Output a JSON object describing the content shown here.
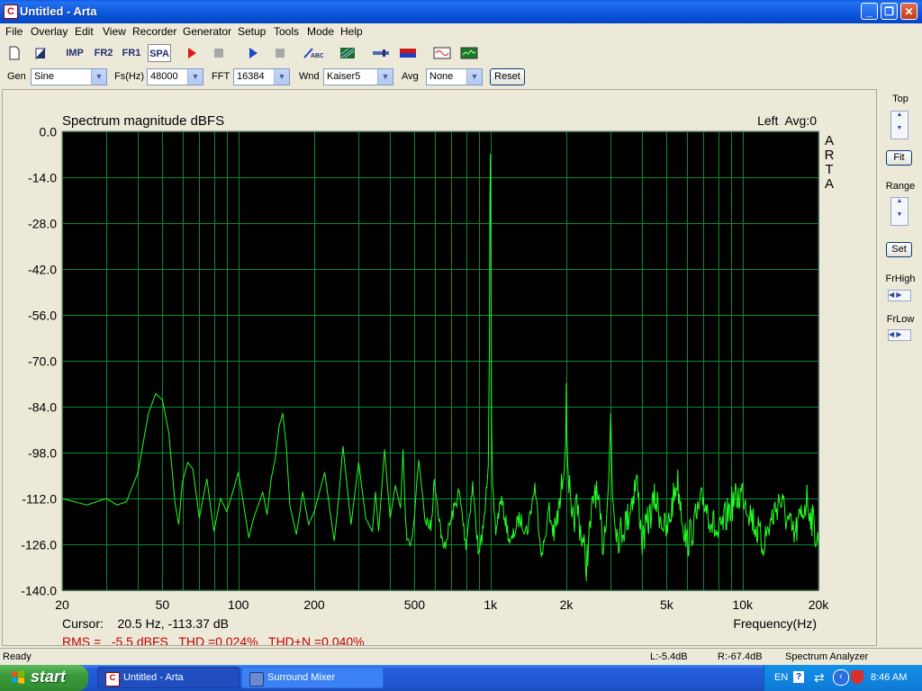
{
  "window": {
    "title": "Untitled - Arta",
    "app_icon_letter": "C"
  },
  "menu": [
    "File",
    "Overlay",
    "Edit",
    "View",
    "Recorder",
    "Generator",
    "Setup",
    "Tools",
    "Mode",
    "Help"
  ],
  "toolbar": {
    "buttons": [
      "new-document-icon",
      "open-icon",
      "impulse-mode",
      "fr2-mode",
      "fr1-mode",
      "spectrum-mode",
      "record-icon",
      "stop-icon",
      "play-icon",
      "stop-icon",
      "abc-icon",
      "grid-icon",
      "marker-icon",
      "color-bar-icon",
      "sine-wave-icon",
      "spectrum-icon"
    ],
    "imp_label": "IMP",
    "fr2_label": "FR2",
    "fr1_label": "FR1",
    "spa_label": "SPA"
  },
  "genbar": {
    "gen_label": "Gen",
    "gen_value": "Sine",
    "fs_label": "Fs(Hz)",
    "fs_value": "48000",
    "fft_label": "FFT",
    "fft_value": "16384",
    "wnd_label": "Wnd",
    "wnd_value": "Kaiser5",
    "avg_label": "Avg",
    "avg_value": "None",
    "reset_label": "Reset"
  },
  "right_panel": {
    "top_label": "Top",
    "fit_label": "Fit",
    "range_label": "Range",
    "set_label": "Set",
    "frhigh_label": "FrHigh",
    "frlow_label": "FrLow"
  },
  "status": {
    "ready": "Ready",
    "left_level": "L:-5.4dB",
    "right_level": "R:-67.4dB",
    "mode": "Spectrum Analyzer"
  },
  "taskbar": {
    "start": "start",
    "tasks": [
      "Untitled - Arta",
      "Surround Mixer"
    ],
    "lang": "EN",
    "time": "8:46 AM"
  },
  "chart_data": {
    "type": "line",
    "title": "Spectrum magnitude dBFS",
    "channel_info": "Left  Avg:0",
    "watermark": "ARTA",
    "xlabel": "Frequency(Hz)",
    "x_scale": "log",
    "xlim": [
      20,
      20000
    ],
    "ylim": [
      -140,
      0
    ],
    "y_ticks": [
      "0.0",
      "-14.0",
      "-28.0",
      "-42.0",
      "-56.0",
      "-70.0",
      "-84.0",
      "-98.0",
      "-112.0",
      "-126.0",
      "-140.0"
    ],
    "x_ticks": [
      "20",
      "50",
      "100",
      "200",
      "500",
      "1k",
      "2k",
      "5k",
      "10k",
      "20k"
    ],
    "grid": true,
    "background": "#000000",
    "grid_color": "#0a8a2a",
    "line_color": "#22ff22",
    "cursor_text": "Cursor:    20.5 Hz, -113.37 dB",
    "rms_text": "RMS =   -5.5 dBFS   THD =0.024%   THD+N =0.040%",
    "series": [
      {
        "x": [
          20,
          25,
          30,
          33,
          36,
          40,
          44,
          47,
          50,
          53,
          56,
          58,
          60,
          63,
          66,
          70,
          75,
          80,
          85,
          90,
          95,
          100,
          105,
          110,
          115,
          120,
          125,
          130,
          135,
          140,
          145,
          150,
          155,
          160,
          170,
          180,
          190,
          200,
          210,
          220,
          240,
          250,
          260,
          280,
          300,
          320,
          340,
          350,
          360,
          380,
          400,
          420,
          440,
          450,
          460,
          480,
          500,
          520,
          550,
          580,
          600,
          650,
          700,
          750,
          800,
          850,
          900,
          950,
          980,
          990,
          995,
          1000,
          1005,
          1010,
          1020,
          1050,
          1100,
          1200,
          1300,
          1400,
          1500,
          1600,
          1700,
          1800,
          1900,
          1980,
          2000,
          2020,
          2100,
          2200,
          2400,
          2600,
          2800,
          2950,
          3000,
          3050,
          3200,
          3500,
          3800,
          4000,
          4500,
          5000,
          5500,
          6000,
          7000,
          8000,
          9000,
          10000,
          12000,
          14000,
          16000,
          18000,
          20000
        ],
        "y": [
          -112,
          -114,
          -112,
          -114,
          -113,
          -104,
          -86,
          -80,
          -82,
          -92,
          -113,
          -120,
          -107,
          -101,
          -103,
          -118,
          -106,
          -122,
          -112,
          -116,
          -110,
          -104,
          -114,
          -124,
          -118,
          -114,
          -110,
          -117,
          -106,
          -100,
          -90,
          -86,
          -96,
          -114,
          -123,
          -110,
          -120,
          -116,
          -110,
          -104,
          -125,
          -112,
          -96,
          -120,
          -101,
          -118,
          -122,
          -110,
          -122,
          -97,
          -118,
          -108,
          -115,
          -97,
          -120,
          -128,
          -117,
          -99,
          -118,
          -121,
          -106,
          -128,
          -118,
          -110,
          -126,
          -108,
          -130,
          -117,
          -100,
          -65,
          -20,
          -8,
          -45,
          -90,
          -110,
          -122,
          -112,
          -126,
          -118,
          -122,
          -108,
          -130,
          -116,
          -123,
          -112,
          -95,
          -82,
          -98,
          -122,
          -114,
          -132,
          -108,
          -126,
          -106,
          -86,
          -110,
          -124,
          -118,
          -106,
          -125,
          -112,
          -123,
          -106,
          -126,
          -112,
          -124,
          -114,
          -110,
          -126,
          -112,
          -124,
          -112,
          -126
        ]
      }
    ]
  }
}
